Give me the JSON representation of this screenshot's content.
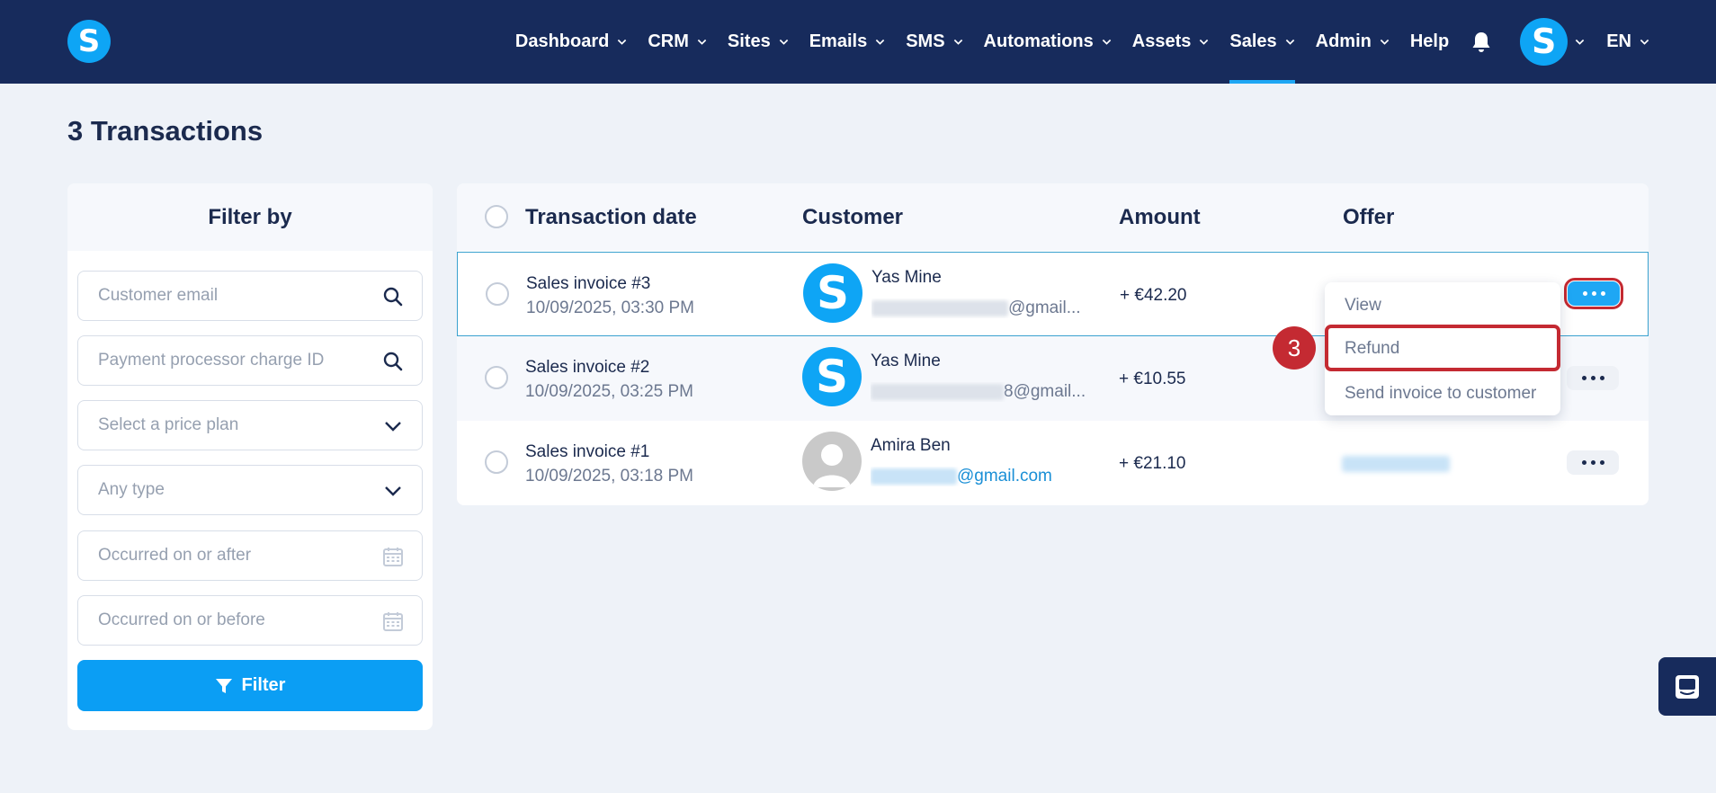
{
  "nav": {
    "logo_letter": "S",
    "items": [
      {
        "label": "Dashboard",
        "has_chevron": true
      },
      {
        "label": "CRM",
        "has_chevron": true
      },
      {
        "label": "Sites",
        "has_chevron": true
      },
      {
        "label": "Emails",
        "has_chevron": true
      },
      {
        "label": "SMS",
        "has_chevron": true
      },
      {
        "label": "Automations",
        "has_chevron": true
      },
      {
        "label": "Assets",
        "has_chevron": true
      },
      {
        "label": "Sales",
        "has_chevron": true,
        "active": true
      },
      {
        "label": "Admin",
        "has_chevron": true
      },
      {
        "label": "Help",
        "has_chevron": false
      }
    ],
    "bell_icon": "bell-icon",
    "avatar_letter": "S",
    "language": "EN"
  },
  "page": {
    "title": "3 Transactions"
  },
  "filter": {
    "header": "Filter by",
    "customer_email_placeholder": "Customer email",
    "charge_id_placeholder": "Payment processor charge ID",
    "price_plan_placeholder": "Select a price plan",
    "type_placeholder": "Any type",
    "after_placeholder": "Occurred on or after",
    "before_placeholder": "Occurred on or before",
    "button_label": "Filter"
  },
  "table": {
    "headers": {
      "date": "Transaction date",
      "customer": "Customer",
      "amount": "Amount",
      "offer": "Offer"
    },
    "rows": [
      {
        "title": "Sales invoice #3",
        "date": "10/09/2025, 03:30 PM",
        "avatar": "S",
        "customer_name": "Yas Mine",
        "email_suffix": "@gmail...",
        "amount": "+ €42.20"
      },
      {
        "title": "Sales invoice #2",
        "date": "10/09/2025, 03:25 PM",
        "avatar": "S",
        "customer_name": "Yas Mine",
        "email_suffix": "8@gmail...",
        "amount": "+ €10.55"
      },
      {
        "title": "Sales invoice #1",
        "date": "10/09/2025, 03:18 PM",
        "avatar": "person-placeholder",
        "customer_name": "Amira Ben",
        "email_suffix": "@gmail.com",
        "amount": "+ €21.10"
      }
    ]
  },
  "menu": {
    "items": [
      "View",
      "Refund",
      "Send invoice to customer"
    ],
    "highlighted": "Refund"
  },
  "annotation": {
    "step_number": "3"
  },
  "colors": {
    "nav_bg": "#172b5c",
    "accent": "#0b9ef4",
    "highlight": "#c42a32",
    "page_bg": "#eef2f8"
  }
}
